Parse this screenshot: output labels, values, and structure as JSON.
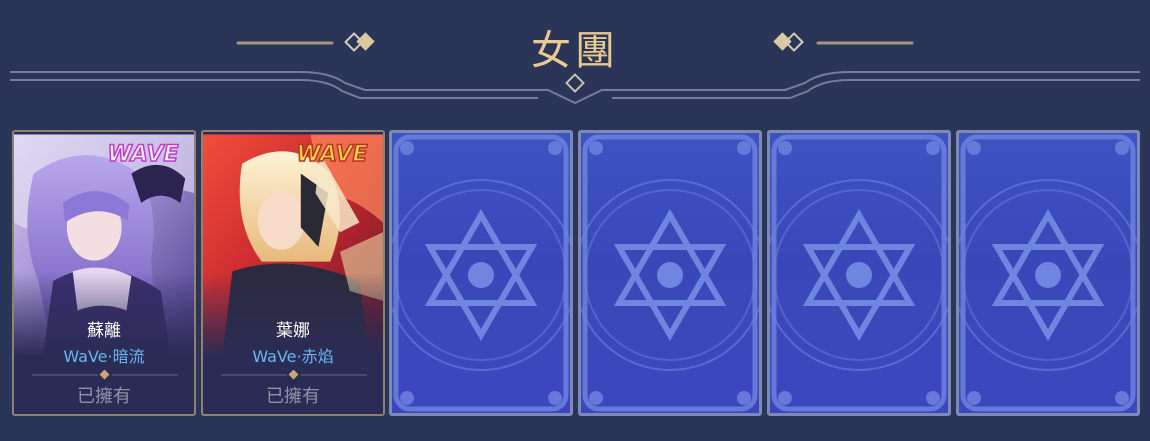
{
  "header": {
    "title": "女團"
  },
  "cards": [
    {
      "hero_name": "蘇離",
      "skin_name": "WaVe·暗流",
      "status": "已擁有",
      "logo_text": "WAVE"
    },
    {
      "hero_name": "葉娜",
      "skin_name": "WaVe·赤焰",
      "status": "已擁有",
      "logo_text": "WAVE"
    }
  ],
  "locked_cards": [
    {
      "icon": "hexagram-icon"
    },
    {
      "icon": "hexagram-icon"
    },
    {
      "icon": "hexagram-icon"
    },
    {
      "icon": "hexagram-icon"
    }
  ],
  "colors": {
    "background": "#2a3558",
    "title": "#e9c98f",
    "ornament": "#b9a985",
    "skin_name": "#67b6ef",
    "status": "#8f93a8",
    "card_back": "#3c4bbd"
  }
}
